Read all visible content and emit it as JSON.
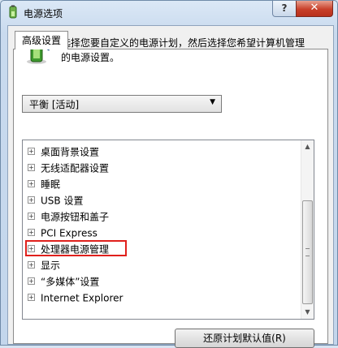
{
  "window": {
    "title": "电源选项",
    "help_glyph": "?",
    "close_glyph": "✕"
  },
  "tab": {
    "label": "高级设置"
  },
  "description": "选择您要自定义的电源计划，然后选择您希望计算机管理的电源设置。",
  "plan_select": {
    "value": "平衡 [活动]",
    "arrow": "▼"
  },
  "tree": {
    "expander_glyph": "+",
    "items": [
      {
        "label": "桌面背景设置"
      },
      {
        "label": "无线适配器设置"
      },
      {
        "label": "睡眠"
      },
      {
        "label": "USB 设置"
      },
      {
        "label": "电源按钮和盖子"
      },
      {
        "label": "PCI Express"
      },
      {
        "label": "处理器电源管理",
        "highlighted": true
      },
      {
        "label": "显示"
      },
      {
        "label": "“多媒体”设置"
      },
      {
        "label": "Internet Explorer"
      }
    ]
  },
  "scrollbar": {
    "up": "▲",
    "down": "▼"
  },
  "buttons": {
    "restore_defaults": "还原计划默认值(R)"
  },
  "colors": {
    "highlight_border": "#e0201c",
    "close_button": "#c8402a"
  }
}
